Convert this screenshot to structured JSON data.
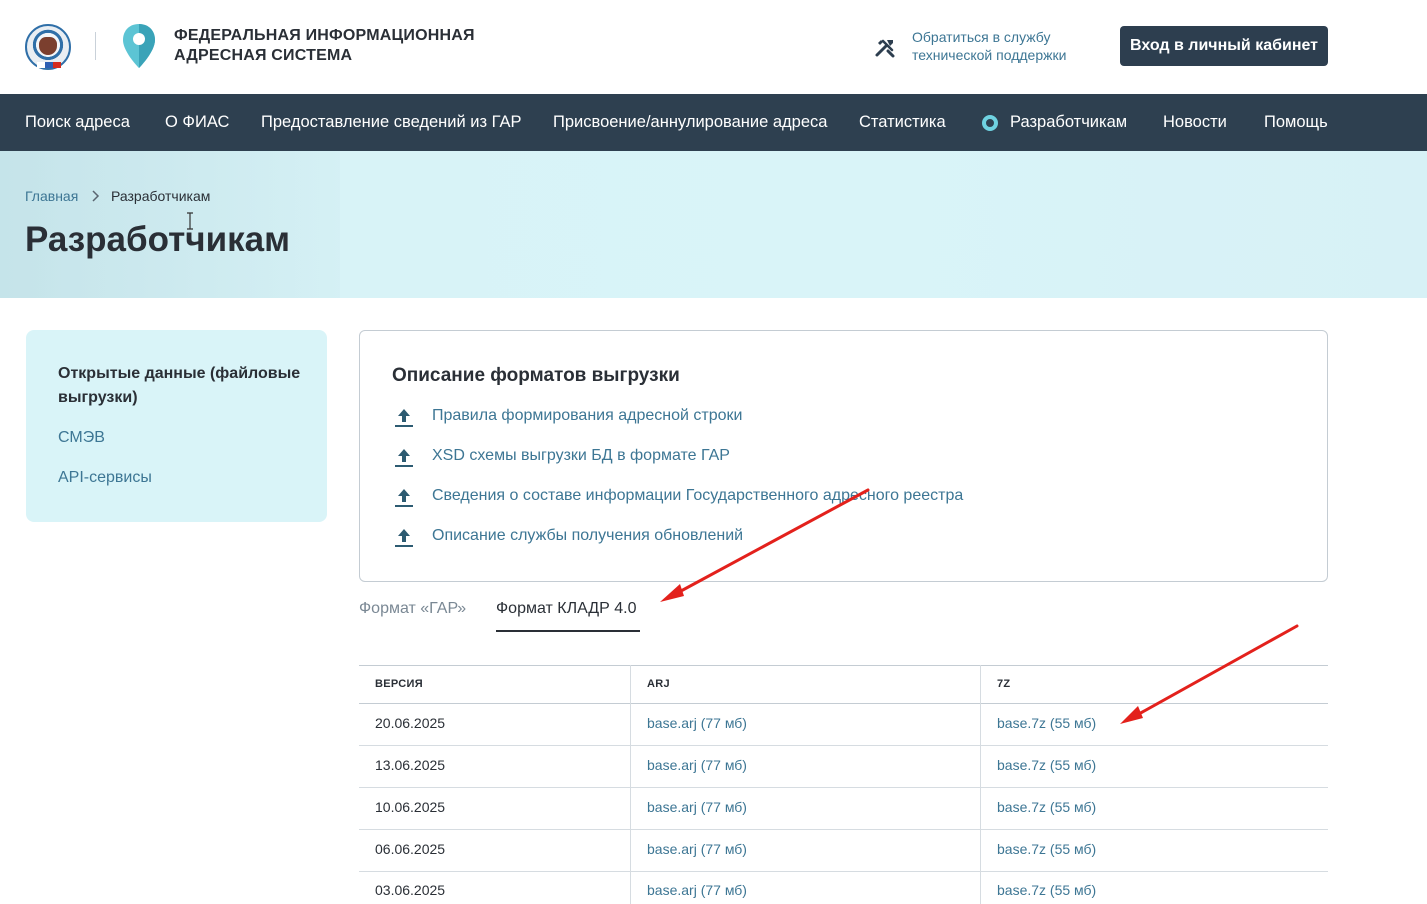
{
  "header": {
    "brand_line1": "ФЕДЕРАЛЬНАЯ ИНФОРМАЦИОННАЯ",
    "brand_line2": "АДРЕСНАЯ СИСТЕМА",
    "support_line1": "Обратиться в службу",
    "support_line2": "технической поддержки",
    "login_label": "Вход в личный кабинет"
  },
  "nav": {
    "items": [
      {
        "label": "Поиск адреса"
      },
      {
        "label": "О ФИАС"
      },
      {
        "label": "Предоставление сведений из ГАР"
      },
      {
        "label": "Присвоение/аннулирование адреса"
      },
      {
        "label": "Статистика"
      },
      {
        "label": "Разработчикам",
        "active": true
      },
      {
        "label": "Новости"
      },
      {
        "label": "Помощь"
      }
    ]
  },
  "breadcrumb": {
    "home": "Главная",
    "current": "Разработчикам"
  },
  "page_title": "Разработчикам",
  "sidebar": {
    "items": [
      {
        "label": "Открытые данные (файловые выгрузки)",
        "active": true
      },
      {
        "label": "СМЭВ"
      },
      {
        "label": "API-сервисы"
      }
    ]
  },
  "formats_card": {
    "title": "Описание форматов выгрузки",
    "links": [
      "Правила формирования адресной строки",
      "XSD схемы выгрузки БД в формате ГАР",
      "Сведения о составе информации Государственного адресного реестра",
      "Описание службы получения обновлений"
    ]
  },
  "tabs": [
    {
      "label": "Формат «ГАР»",
      "active": false
    },
    {
      "label": "Формат КЛАДР 4.0",
      "active": true
    }
  ],
  "table": {
    "headers": [
      "ВЕРСИЯ",
      "ARJ",
      "7Z"
    ],
    "rows": [
      [
        "20.06.2025",
        "base.arj (77 мб)",
        "base.7z (55 мб)"
      ],
      [
        "13.06.2025",
        "base.arj (77 мб)",
        "base.7z (55 мб)"
      ],
      [
        "10.06.2025",
        "base.arj (77 мб)",
        "base.7z (55 мб)"
      ],
      [
        "06.06.2025",
        "base.arj (77 мб)",
        "base.7z (55 мб)"
      ],
      [
        "03.06.2025",
        "base.arj (77 мб)",
        "base.7z (55 мб)"
      ]
    ]
  },
  "colors": {
    "nav_bg": "#2e4050",
    "accent_link": "#3d7694",
    "hero_bg": "#d9f4f8",
    "active_dot": "#6fd2e1",
    "annotation_arrow": "#e3211c"
  },
  "icons": [
    "fns-emblem-icon",
    "map-pin-logo-icon",
    "tools-icon",
    "chevron-right-icon",
    "download-icon",
    "text-cursor-icon",
    "arrow-annotation"
  ]
}
